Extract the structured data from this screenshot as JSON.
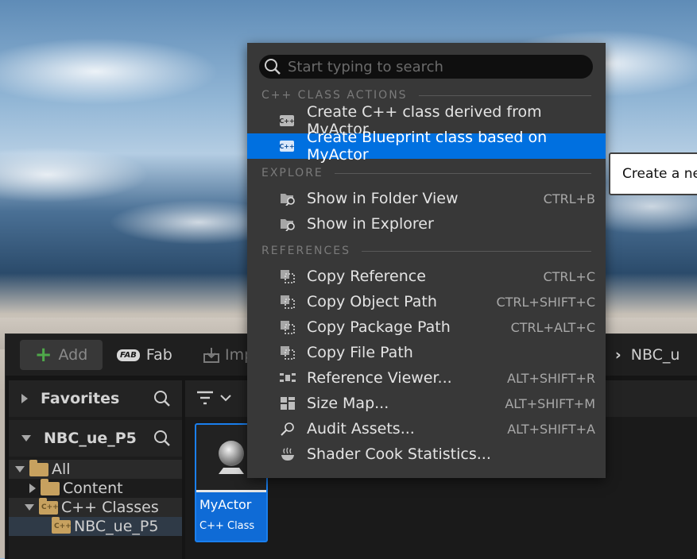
{
  "menu": {
    "search_placeholder": "Start typing to search",
    "sections": {
      "cpp": "C++ CLASS ACTIONS",
      "explore": "EXPLORE",
      "references": "REFERENCES"
    },
    "items": {
      "create_cpp": "Create C++ class derived from MyActor",
      "create_bp": "Create Blueprint class based on MyActor",
      "folder_view": "Show in Folder View",
      "folder_view_sc": "CTRL+B",
      "explorer": "Show in Explorer",
      "copy_ref": "Copy Reference",
      "copy_ref_sc": "CTRL+C",
      "copy_obj": "Copy Object Path",
      "copy_obj_sc": "CTRL+SHIFT+C",
      "copy_pkg": "Copy Package Path",
      "copy_pkg_sc": "CTRL+ALT+C",
      "copy_file": "Copy File Path",
      "ref_viewer": "Reference Viewer...",
      "ref_viewer_sc": "ALT+SHIFT+R",
      "size_map": "Size Map...",
      "size_map_sc": "ALT+SHIFT+M",
      "audit": "Audit Assets...",
      "audit_sc": "ALT+SHIFT+A",
      "shader": "Shader Cook Statistics..."
    }
  },
  "tooltip": "Create a new",
  "toolbar": {
    "add": "Add",
    "fab": "Fab",
    "fab_logo": "FAB",
    "import": "Imp",
    "crumb_partial": "s",
    "crumb_sep": "›",
    "crumb_project": "NBC_u"
  },
  "sidebar": {
    "favorites": "Favorites",
    "project": "NBC_ue_P5",
    "tree": {
      "all": "All",
      "content": "Content",
      "cpp_classes": "C++ Classes",
      "project_folder": "NBC_ue_P5"
    }
  },
  "asset": {
    "name": "MyActor",
    "type": "C++ Class"
  }
}
